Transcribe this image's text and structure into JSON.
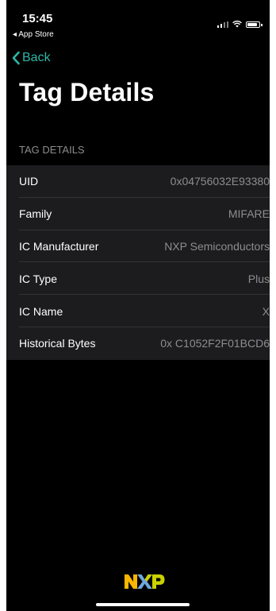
{
  "status_bar": {
    "time": "15:45",
    "back_to_app": "◂ App Store"
  },
  "nav": {
    "back_label": "Back"
  },
  "title": "Tag Details",
  "section_header": "TAG DETAILS",
  "details": [
    {
      "label": "UID",
      "value": "0x04756032E93380"
    },
    {
      "label": "Family",
      "value": "MIFARE"
    },
    {
      "label": "IC Manufacturer",
      "value": "NXP Semiconductors"
    },
    {
      "label": "IC Type",
      "value": "Plus"
    },
    {
      "label": "IC Name",
      "value": "X"
    },
    {
      "label": "Historical Bytes",
      "value": "0x C1052F2F01BCD6"
    }
  ],
  "logo": "NXP",
  "colors": {
    "accent": "#2fb6a6",
    "background": "#000000",
    "list_background": "#1c1c1e",
    "secondary_text": "#8d8d92",
    "logo_yellow": "#f9b500",
    "logo_blue": "#6ea7da",
    "logo_green": "#c9d200"
  },
  "icons": [
    "signal-icon",
    "wifi-icon",
    "battery-icon",
    "chevron-left-icon",
    "nxp-logo"
  ]
}
